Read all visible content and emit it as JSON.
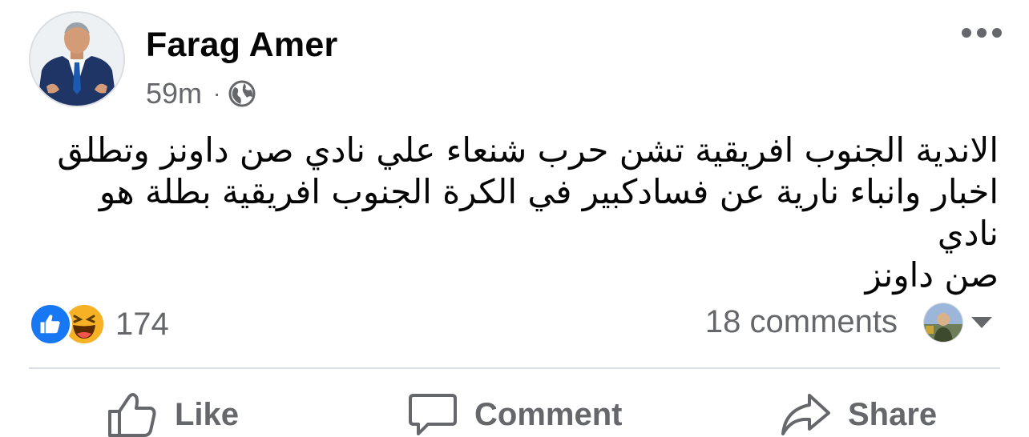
{
  "post": {
    "author": "Farag Amer",
    "time": "59m",
    "separator": "·",
    "privacy_icon": "globe-icon",
    "text": "الاندية الجنوب افريقية تشن حرب شنعاء علي نادي صن داونز وتطلق\nاخبار وانباء نارية عن فسادكبير في الكرة الجنوب افريقية بطلة هو نادي\nصن داونز"
  },
  "stats": {
    "reaction_icons": [
      "like-reaction-icon",
      "haha-reaction-icon"
    ],
    "reaction_count": "174",
    "comments": "18 comments"
  },
  "actions": {
    "like": "Like",
    "comment": "Comment",
    "share": "Share"
  },
  "colors": {
    "like_blue": "#1877f2",
    "secondary_text": "#65676b",
    "divider": "#dadde1",
    "haha_yellow": "#f7b125"
  }
}
